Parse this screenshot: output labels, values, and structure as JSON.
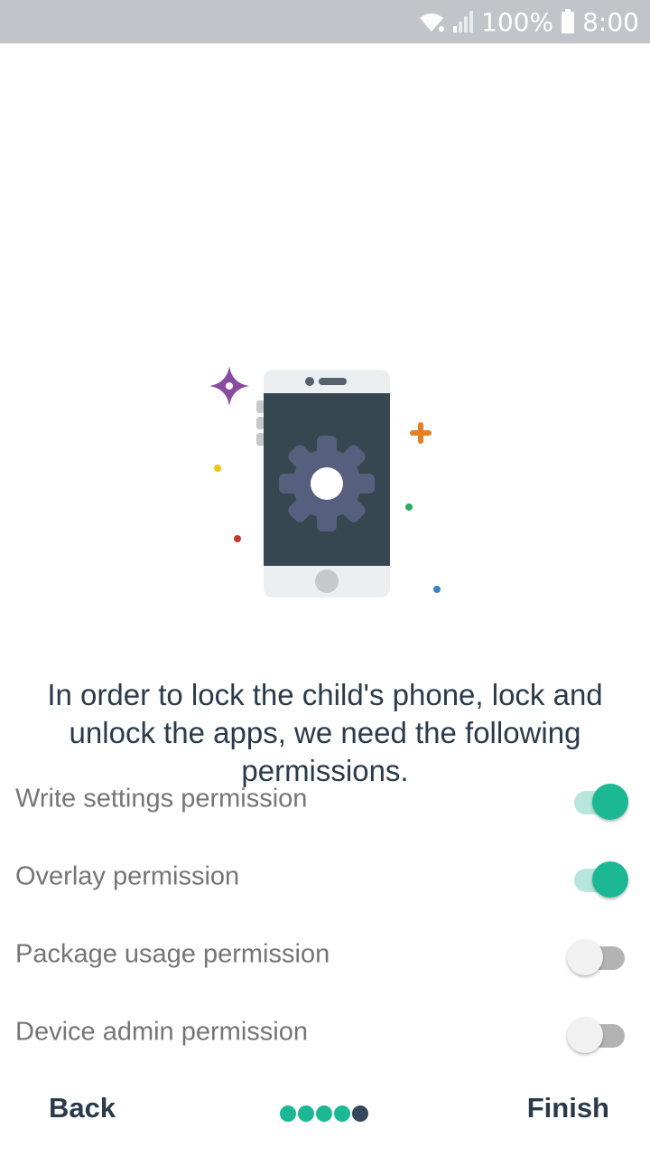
{
  "status_bar": {
    "battery_text": "100%",
    "time": "8:00",
    "icons": [
      "wifi-icon",
      "signal-icon",
      "battery-icon"
    ]
  },
  "illustration": {
    "icon": "phone-settings-illustration",
    "colors": {
      "phone_body": "#eceff1",
      "phone_screen": "#37474f",
      "gear": "#56607e",
      "sparkle_purple": "#8a4aa0",
      "plus_orange": "#e67e22"
    }
  },
  "main": {
    "message": "In order to lock the child's phone, lock and unlock the apps, we need the following permissions."
  },
  "permissions": [
    {
      "label": "Write settings permission",
      "enabled": true
    },
    {
      "label": "Overlay permission",
      "enabled": true
    },
    {
      "label": "Package usage permission",
      "enabled": false
    },
    {
      "label": "Device admin permission",
      "enabled": false
    }
  ],
  "footer": {
    "back_label": "Back",
    "finish_label": "Finish",
    "pager": {
      "total": 5,
      "current": 5
    }
  },
  "colors": {
    "accent": "#1cb894",
    "text_dark": "#2b3a4a",
    "text_muted": "#757575"
  }
}
